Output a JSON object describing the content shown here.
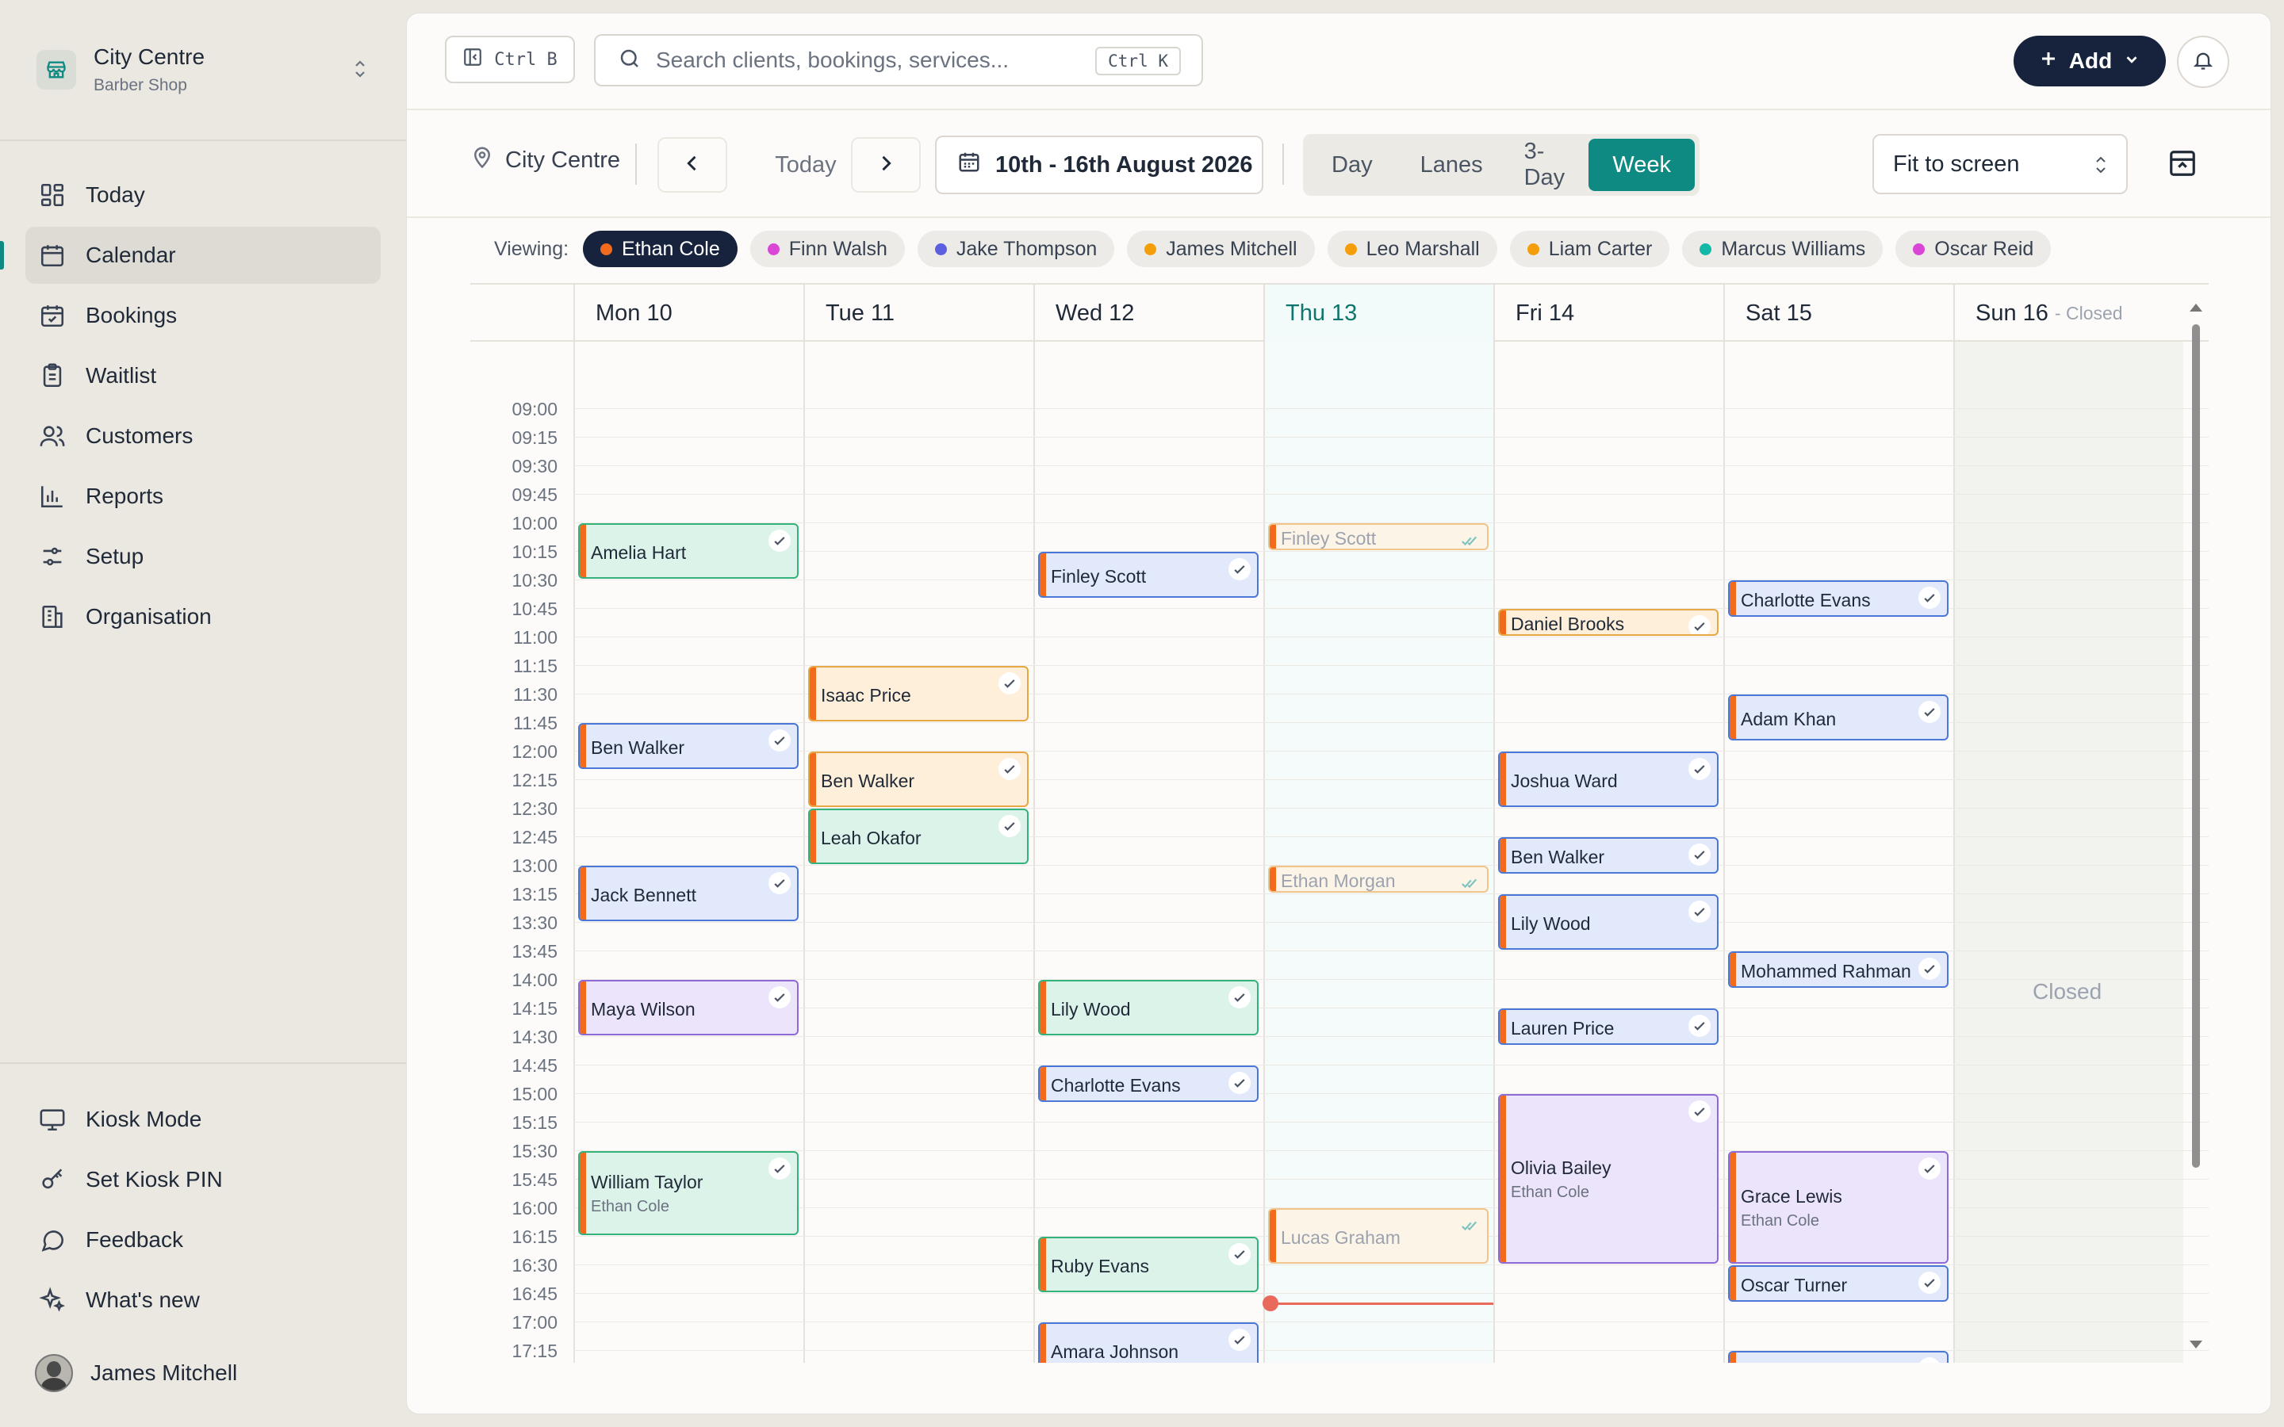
{
  "sidebar": {
    "org_name": "City Centre",
    "org_type": "Barber Shop",
    "nav": [
      {
        "label": "Today",
        "icon": "dashboard-icon",
        "active": false
      },
      {
        "label": "Calendar",
        "icon": "calendar-icon",
        "active": true
      },
      {
        "label": "Bookings",
        "icon": "calendar-check-icon",
        "active": false
      },
      {
        "label": "Waitlist",
        "icon": "clipboard-list-icon",
        "active": false
      },
      {
        "label": "Customers",
        "icon": "users-icon",
        "active": false
      },
      {
        "label": "Reports",
        "icon": "bar-chart-icon",
        "active": false
      },
      {
        "label": "Setup",
        "icon": "sliders-icon",
        "active": false
      },
      {
        "label": "Organisation",
        "icon": "building-icon",
        "active": false
      }
    ],
    "bottom": [
      {
        "label": "Kiosk Mode",
        "icon": "monitor-icon"
      },
      {
        "label": "Set Kiosk PIN",
        "icon": "key-icon"
      },
      {
        "label": "Feedback",
        "icon": "message-icon"
      },
      {
        "label": "What's new",
        "icon": "sparkles-icon"
      }
    ],
    "user_name": "James Mitchell"
  },
  "topbar": {
    "sidebar_shortcut": "Ctrl B",
    "search_placeholder": "Search clients, bookings, services...",
    "search_shortcut": "Ctrl K",
    "add_label": "Add"
  },
  "toolbar": {
    "location": "City Centre",
    "today_label": "Today",
    "date_range": "10th - 16th August 2026",
    "views": [
      "Day",
      "Lanes",
      "3-Day",
      "Week"
    ],
    "active_view": "Week",
    "zoom": "Fit to screen"
  },
  "viewing": {
    "label": "Viewing:",
    "staff": [
      {
        "name": "Ethan Cole",
        "color": "#f26b1d",
        "active": true
      },
      {
        "name": "Finn Walsh",
        "color": "#d946d6",
        "active": false
      },
      {
        "name": "Jake Thompson",
        "color": "#5b5fe0",
        "active": false
      },
      {
        "name": "James Mitchell",
        "color": "#f59e0b",
        "active": false
      },
      {
        "name": "Leo Marshall",
        "color": "#f59e0b",
        "active": false
      },
      {
        "name": "Liam Carter",
        "color": "#f59e0b",
        "active": false
      },
      {
        "name": "Marcus Williams",
        "color": "#14b8a6",
        "active": false
      },
      {
        "name": "Oscar Reid",
        "color": "#d946d6",
        "active": false
      }
    ]
  },
  "calendar": {
    "days": [
      {
        "label": "Mon 10",
        "today": false,
        "closed": false
      },
      {
        "label": "Tue 11",
        "today": false,
        "closed": false
      },
      {
        "label": "Wed 12",
        "today": false,
        "closed": false
      },
      {
        "label": "Thu 13",
        "today": true,
        "closed": false
      },
      {
        "label": "Fri 14",
        "today": false,
        "closed": false
      },
      {
        "label": "Sat 15",
        "today": false,
        "closed": false
      },
      {
        "label": "Sun 16",
        "today": false,
        "closed": true
      }
    ],
    "closed_note": "- Closed",
    "closed_label": "Closed",
    "times": [
      "09:00",
      "09:15",
      "09:30",
      "09:45",
      "10:00",
      "10:15",
      "10:30",
      "10:45",
      "11:00",
      "11:15",
      "11:30",
      "11:45",
      "12:00",
      "12:15",
      "12:30",
      "12:45",
      "13:00",
      "13:15",
      "13:30",
      "13:45",
      "14:00",
      "14:15",
      "14:30",
      "14:45",
      "15:00",
      "15:15",
      "15:30",
      "15:45",
      "16:00",
      "16:15",
      "16:30",
      "16:45",
      "17:00",
      "17:15"
    ],
    "now_time": "16:50",
    "appointments": [
      {
        "day": 0,
        "start": "10:00",
        "end": "10:30",
        "name": "Amelia Hart",
        "color": "green"
      },
      {
        "day": 0,
        "start": "11:45",
        "end": "12:10",
        "name": "Ben Walker",
        "color": "blue"
      },
      {
        "day": 0,
        "start": "13:00",
        "end": "13:30",
        "name": "Jack Bennett",
        "color": "blue"
      },
      {
        "day": 0,
        "start": "14:00",
        "end": "14:30",
        "name": "Maya Wilson",
        "color": "purple"
      },
      {
        "day": 0,
        "start": "15:30",
        "end": "16:15",
        "name": "William Taylor",
        "staff": "Ethan Cole",
        "color": "green"
      },
      {
        "day": 1,
        "start": "11:15",
        "end": "11:45",
        "name": "Isaac Price",
        "color": "yellow"
      },
      {
        "day": 1,
        "start": "12:00",
        "end": "12:30",
        "name": "Ben Walker",
        "color": "yellow"
      },
      {
        "day": 1,
        "start": "12:30",
        "end": "13:00",
        "name": "Leah Okafor",
        "color": "green"
      },
      {
        "day": 2,
        "start": "10:15",
        "end": "10:40",
        "name": "Finley Scott",
        "color": "blue"
      },
      {
        "day": 2,
        "start": "14:00",
        "end": "14:30",
        "name": "Lily Wood",
        "color": "green"
      },
      {
        "day": 2,
        "start": "14:45",
        "end": "15:05",
        "name": "Charlotte Evans",
        "color": "blue"
      },
      {
        "day": 2,
        "start": "16:15",
        "end": "16:45",
        "name": "Ruby Evans",
        "color": "green"
      },
      {
        "day": 2,
        "start": "17:00",
        "end": "17:30",
        "name": "Amara Johnson",
        "color": "blue"
      },
      {
        "day": 3,
        "start": "10:00",
        "end": "10:15",
        "name": "Finley Scott",
        "color": "faded"
      },
      {
        "day": 3,
        "start": "13:00",
        "end": "13:15",
        "name": "Ethan Morgan",
        "color": "faded"
      },
      {
        "day": 3,
        "start": "16:00",
        "end": "16:30",
        "name": "Lucas Graham",
        "color": "faded"
      },
      {
        "day": 4,
        "start": "10:45",
        "end": "11:00",
        "name": "Daniel Brooks",
        "color": "yellow"
      },
      {
        "day": 4,
        "start": "12:00",
        "end": "12:30",
        "name": "Joshua Ward",
        "color": "blue"
      },
      {
        "day": 4,
        "start": "12:45",
        "end": "13:05",
        "name": "Ben Walker",
        "color": "blue"
      },
      {
        "day": 4,
        "start": "13:15",
        "end": "13:45",
        "name": "Lily Wood",
        "color": "blue"
      },
      {
        "day": 4,
        "start": "14:15",
        "end": "14:35",
        "name": "Lauren Price",
        "color": "blue"
      },
      {
        "day": 4,
        "start": "15:00",
        "end": "16:30",
        "name": "Olivia Bailey",
        "staff": "Ethan Cole",
        "color": "purple"
      },
      {
        "day": 5,
        "start": "10:30",
        "end": "10:50",
        "name": "Charlotte Evans",
        "color": "blue"
      },
      {
        "day": 5,
        "start": "11:30",
        "end": "11:55",
        "name": "Adam Khan",
        "color": "blue"
      },
      {
        "day": 5,
        "start": "13:45",
        "end": "14:05",
        "name": "Mohammed Rahman",
        "color": "blue"
      },
      {
        "day": 5,
        "start": "15:30",
        "end": "16:30",
        "name": "Grace Lewis",
        "staff": "Ethan Cole",
        "color": "purple"
      },
      {
        "day": 5,
        "start": "16:30",
        "end": "16:50",
        "name": "Oscar Turner",
        "color": "blue"
      },
      {
        "day": 5,
        "start": "17:15",
        "end": "17:35",
        "name": "",
        "color": "blue"
      }
    ]
  }
}
